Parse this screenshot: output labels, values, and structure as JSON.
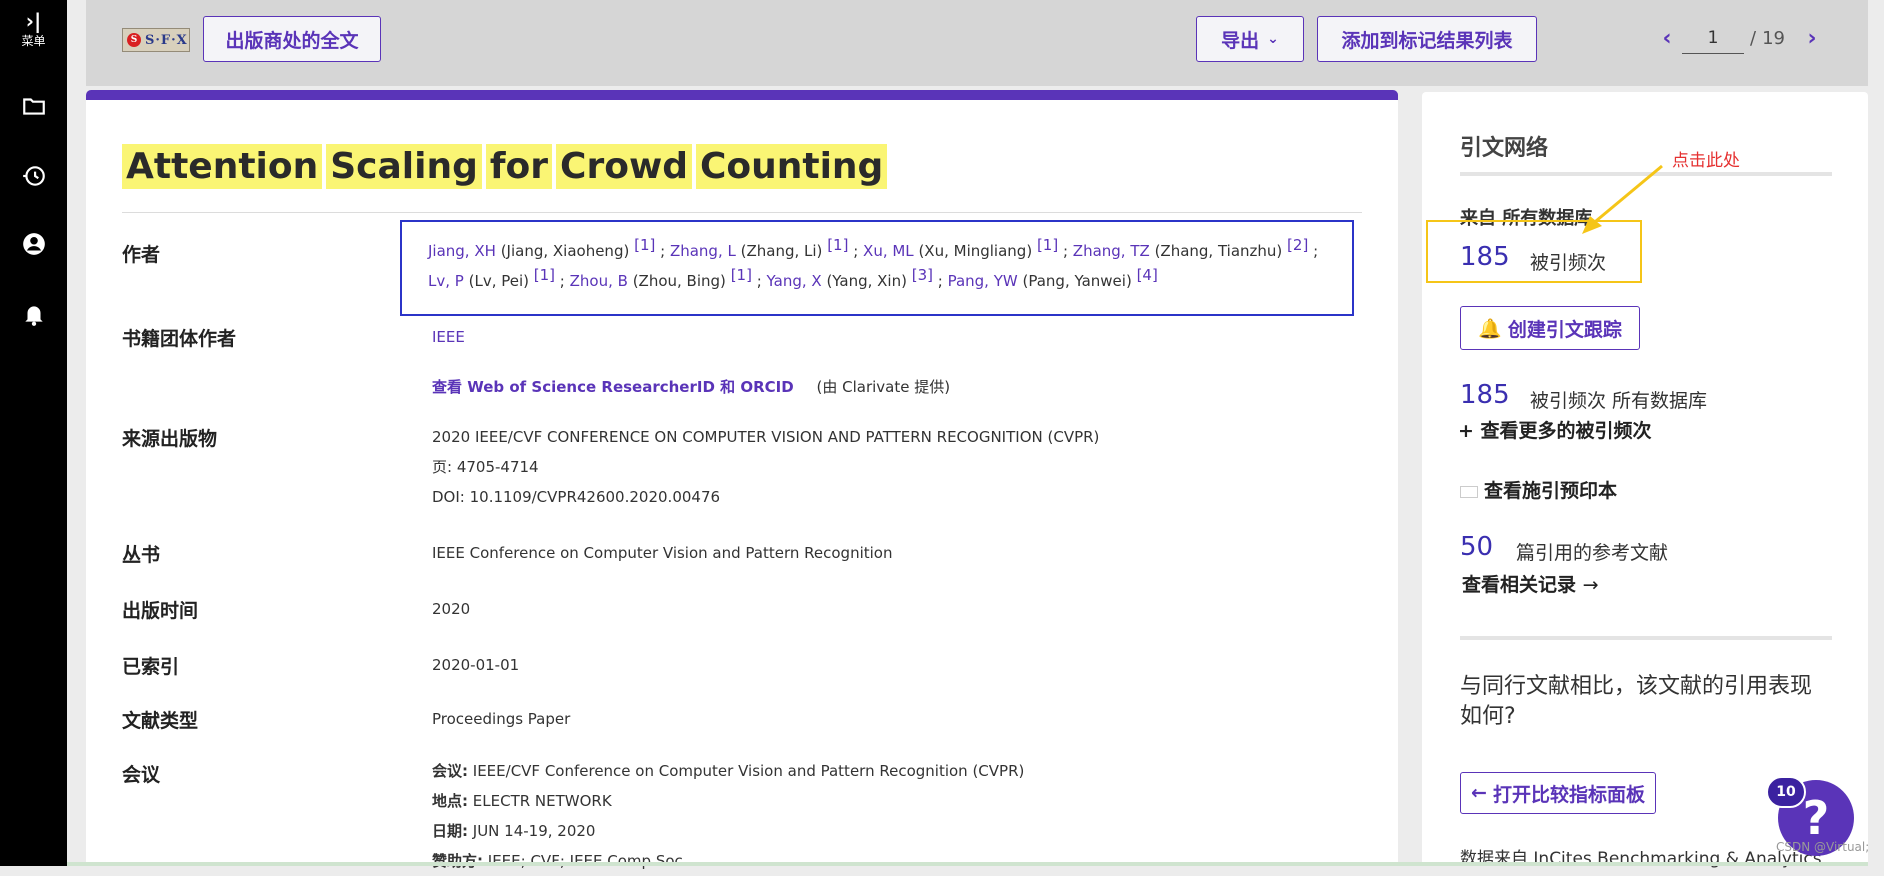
{
  "rail": {
    "menu_label": "菜单"
  },
  "toolbar": {
    "sfx_logo": "S·F·X",
    "fulltext_label": "出版商处的全文",
    "export_label": "导出",
    "add_mark_label": "添加到标记结果列表",
    "page_current": "1",
    "page_sep": "/",
    "page_total": "19"
  },
  "record": {
    "title_words": [
      "Attention",
      "Scaling",
      "for",
      "Crowd",
      "Counting"
    ],
    "author_label": "作者",
    "authors": [
      {
        "abbr": "Jiang, XH",
        "full": "(Jiang, Xiaoheng)",
        "ref": "[1]"
      },
      {
        "abbr": "Zhang, L",
        "full": "(Zhang, Li)",
        "ref": "[1]"
      },
      {
        "abbr": "Xu, ML",
        "full": "(Xu, Mingliang)",
        "ref": "[1]"
      },
      {
        "abbr": "Zhang, TZ",
        "full": "(Zhang, Tianzhu)",
        "ref": "[2]"
      },
      {
        "abbr": "Lv, P",
        "full": "(Lv, Pei)",
        "ref": "[1]"
      },
      {
        "abbr": "Zhou, B",
        "full": "(Zhou, Bing)",
        "ref": "[1]"
      },
      {
        "abbr": "Yang, X",
        "full": "(Yang, Xin)",
        "ref": "[3]"
      },
      {
        "abbr": "Pang, YW",
        "full": "(Pang, Yanwei)",
        "ref": "[4]"
      }
    ],
    "group_author_label": "书籍团体作者",
    "group_author": "IEEE",
    "researcher_link": "查看 Web of Science ResearcherID 和 ORCID",
    "researcher_note": "(由 Clarivate 提供)",
    "source_label": "来源出版物",
    "source_name": "2020 IEEE/CVF CONFERENCE ON COMPUTER VISION AND PATTERN RECOGNITION (CVPR)",
    "source_pages": "页: 4705-4714",
    "source_doi": "DOI: 10.1109/CVPR42600.2020.00476",
    "series_label": "丛书",
    "series": "IEEE Conference on Computer Vision and Pattern Recognition",
    "pubdate_label": "出版时间",
    "pubdate": "2020",
    "indexed_label": "已索引",
    "indexed": "2020-01-01",
    "doctype_label": "文献类型",
    "doctype": "Proceedings Paper",
    "conf_label": "会议",
    "conf_name_key": "会议:",
    "conf_name": "IEEE/CVF Conference on Computer Vision and Pattern Recognition (CVPR)",
    "conf_loc_key": "地点:",
    "conf_loc": "ELECTR NETWORK",
    "conf_date_key": "日期:",
    "conf_date": "JUN 14-19, 2020",
    "conf_sponsor_key": "赞助方:",
    "conf_sponsor": "IEEE; CVF; IEEE Comp Soc"
  },
  "side": {
    "title": "引文网络",
    "from_db": "来自 所有数据库",
    "cited_count": "185",
    "cited_label": "被引频次",
    "create_alert": "创建引文跟踪",
    "cited_count2": "185",
    "cited_all_label": "被引频次 所有数据库",
    "more_cites": "+ 查看更多的被引频次",
    "preprint": "查看施引预印本",
    "refs_count": "50",
    "refs_label": "篇引用的参考文献",
    "related": "查看相关记录",
    "compare_q": "与同行文献相比，该文献的引用表现如何?",
    "open_dashboard": "打开比较指标面板",
    "data_from": "数据来自 InCites Benchmarking & Analytics"
  },
  "annotation": {
    "callout": "点击此处",
    "color": "#f5c518"
  },
  "help": {
    "badge": "10",
    "glyph": "?"
  },
  "watermark": "CSDN @Virtual;",
  "colors": {
    "accent": "#5a34b8",
    "highlight": "#faf574",
    "callout": "#f5c518",
    "annotation_text": "#e53030"
  }
}
